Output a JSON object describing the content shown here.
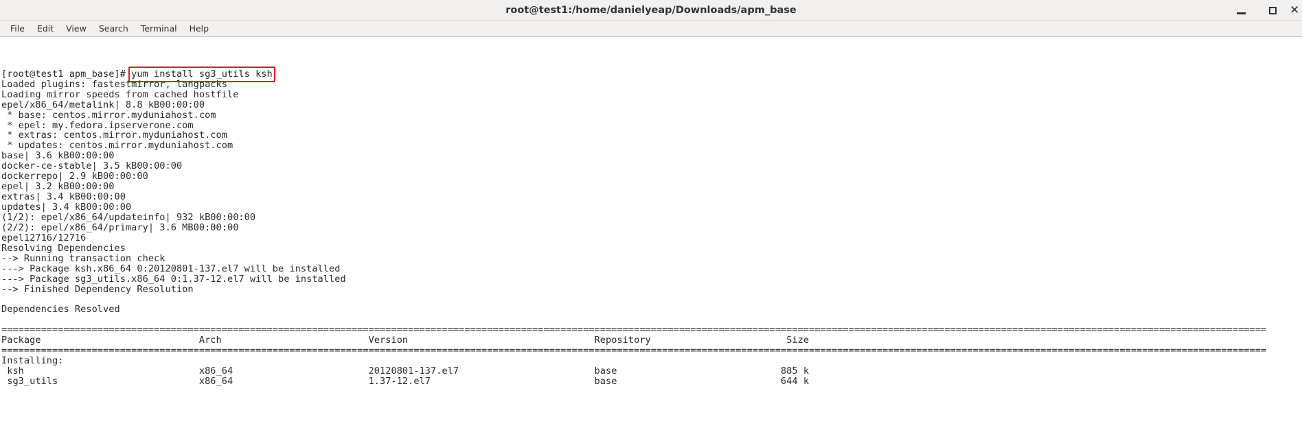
{
  "window": {
    "title": "root@test1:/home/danielyeap/Downloads/apm_base",
    "controls": {
      "minimize": "–",
      "maximize": "■",
      "close": "✕"
    }
  },
  "menubar": {
    "items": [
      {
        "label": "File"
      },
      {
        "label": "Edit"
      },
      {
        "label": "View"
      },
      {
        "label": "Search"
      },
      {
        "label": "Terminal"
      },
      {
        "label": "Help"
      }
    ]
  },
  "highlight": {
    "color": "#e01b1b",
    "target_text": "yum install sg3_utils ksh"
  },
  "terminal": {
    "prompt": "[root@test1 apm_base]# ",
    "command": "yum install sg3_utils ksh",
    "lines": [
      {
        "left": "Loaded plugins: fastestmirror, langpacks"
      },
      {
        "left": "Loading mirror speeds from cached hostfile"
      },
      {
        "left": "epel/x86_64/metalink",
        "size": "| 8.8 kB",
        "time": "00:00:00"
      },
      {
        "left": " * base: centos.mirror.myduniahost.com"
      },
      {
        "left": " * epel: my.fedora.ipserverone.com"
      },
      {
        "left": " * extras: centos.mirror.myduniahost.com"
      },
      {
        "left": " * updates: centos.mirror.myduniahost.com"
      },
      {
        "left": "base",
        "size": "| 3.6 kB",
        "time": "00:00:00"
      },
      {
        "left": "docker-ce-stable",
        "size": "| 3.5 kB",
        "time": "00:00:00"
      },
      {
        "left": "dockerrepo",
        "size": "| 2.9 kB",
        "time": "00:00:00"
      },
      {
        "left": "epel",
        "size": "| 3.2 kB",
        "time": "00:00:00"
      },
      {
        "left": "extras",
        "size": "| 3.4 kB",
        "time": "00:00:00"
      },
      {
        "left": "updates",
        "size": "| 3.4 kB",
        "time": "00:00:00"
      },
      {
        "left": "(1/2): epel/x86_64/updateinfo",
        "size": "| 932 kB",
        "time": "00:00:00"
      },
      {
        "left": "(2/2): epel/x86_64/primary",
        "size": "| 3.6 MB",
        "time": "00:00:00"
      },
      {
        "left": "epel",
        "size": "",
        "time": "12716/12716"
      },
      {
        "left": "Resolving Dependencies"
      },
      {
        "left": "--> Running transaction check"
      },
      {
        "left": "---> Package ksh.x86_64 0:20120801-137.el7 will be installed"
      },
      {
        "left": "---> Package sg3_utils.x86_64 0:1.37-12.el7 will be installed"
      },
      {
        "left": "--> Finished Dependency Resolution"
      },
      {
        "left": ""
      },
      {
        "left": "Dependencies Resolved"
      },
      {
        "left": ""
      },
      {
        "left": "================================================================================================================================================================================================================================"
      },
      {
        "left": "Package                            Arch                          Version                                 Repository                        Size"
      },
      {
        "left": "================================================================================================================================================================================================================================"
      },
      {
        "left": "Installing:"
      },
      {
        "left": " ksh                               x86_64                        20120801-137.el7                        base                             885 k"
      },
      {
        "left": " sg3_utils                         x86_64                        1.37-12.el7                             base                             644 k"
      }
    ],
    "table": {
      "headers": [
        "Package",
        "Arch",
        "Version",
        "Repository",
        "Size"
      ],
      "section_label": "Installing:",
      "rows": [
        {
          "package": "ksh",
          "arch": "x86_64",
          "version": "20120801-137.el7",
          "repository": "base",
          "size": "885 k"
        },
        {
          "package": "sg3_utils",
          "arch": "x86_64",
          "version": "1.37-12.el7",
          "repository": "base",
          "size": "644 k"
        }
      ]
    }
  }
}
